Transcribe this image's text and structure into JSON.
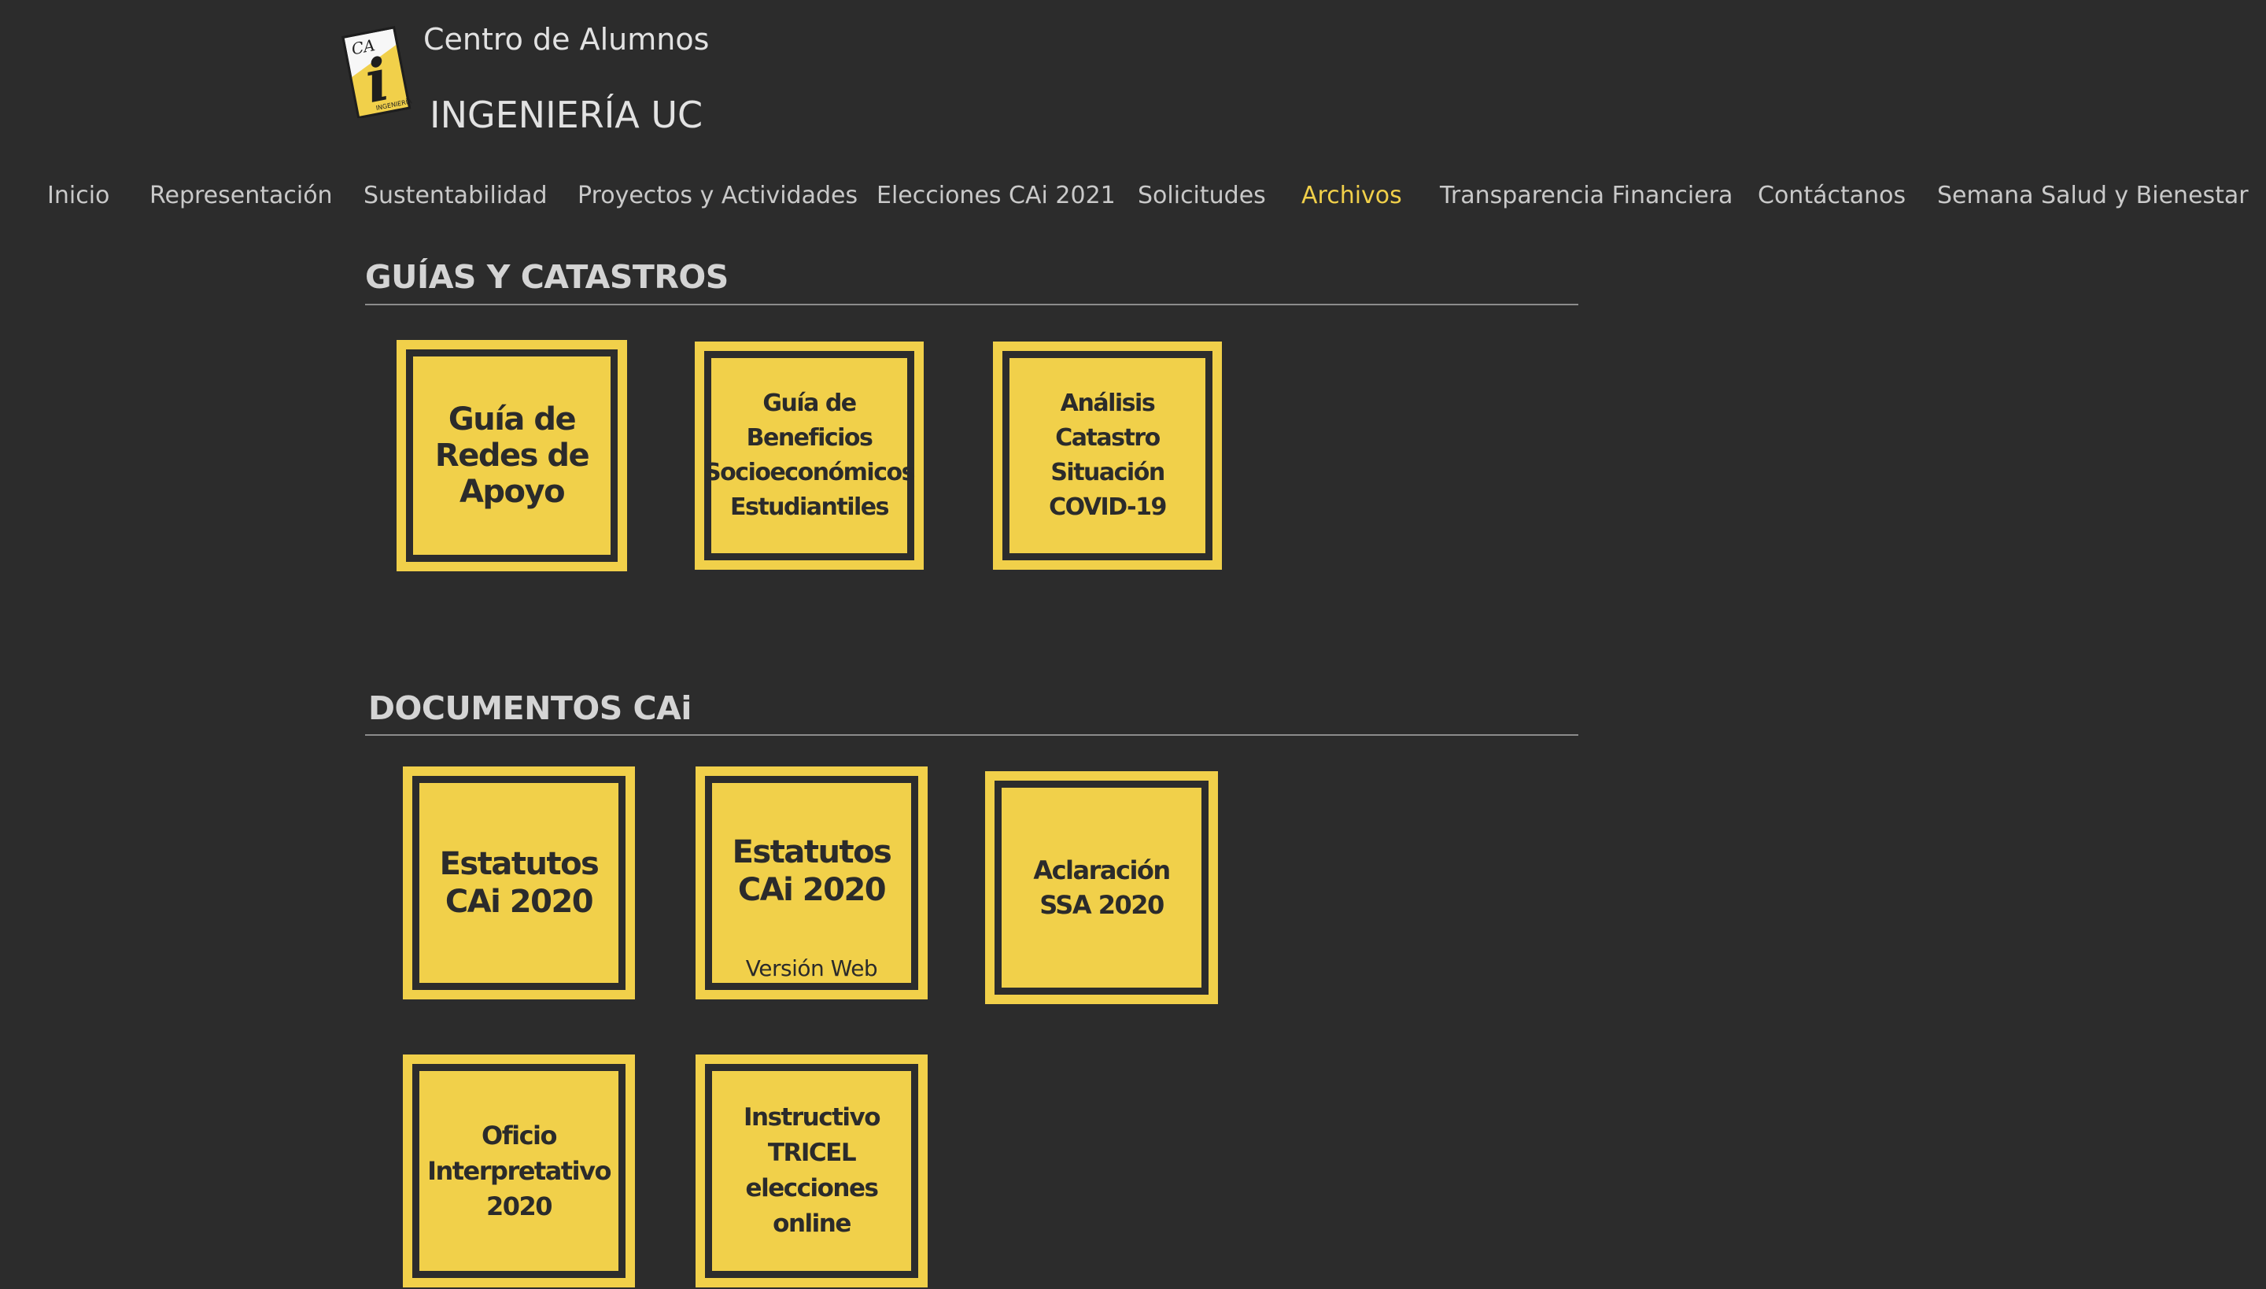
{
  "header": {
    "title_line1": "Centro de Alumnos",
    "title_line2": "INGENIERÍA UC",
    "logo_text_top": "CA",
    "logo_text_big": "i",
    "logo_text_small": "INGENIERÍA"
  },
  "nav": {
    "items": [
      "Inicio",
      "Representación",
      "Sustentabilidad",
      "Proyectos y Actividades",
      "Elecciones CAi 2021",
      "Solicitudes",
      "Archivos",
      "Transparencia Financiera",
      "Contáctanos",
      "Semana Salud y Bienestar"
    ],
    "active": "Archivos"
  },
  "sections": {
    "guias": {
      "title": "GUÍAS Y CATASTROS",
      "tiles": [
        "Guía de Redes de Apoyo",
        "Guía de Beneficios Socioeconómicos Estudiantiles",
        "Análisis Catastro Situación COVID-19"
      ]
    },
    "documentos": {
      "title": "DOCUMENTOS CAi",
      "tiles": [
        "Estatutos CAi 2020",
        "Estatutos CAi 2020",
        "Aclaración SSA 2020",
        "Oficio Interpretativo 2020",
        "Instructivo TRICEL elecciones online"
      ],
      "tile_note": "Versión Web"
    }
  },
  "colors": {
    "background": "#2c2c2c",
    "accent_yellow": "#f1d04a",
    "text_light": "#d9d9d9"
  }
}
